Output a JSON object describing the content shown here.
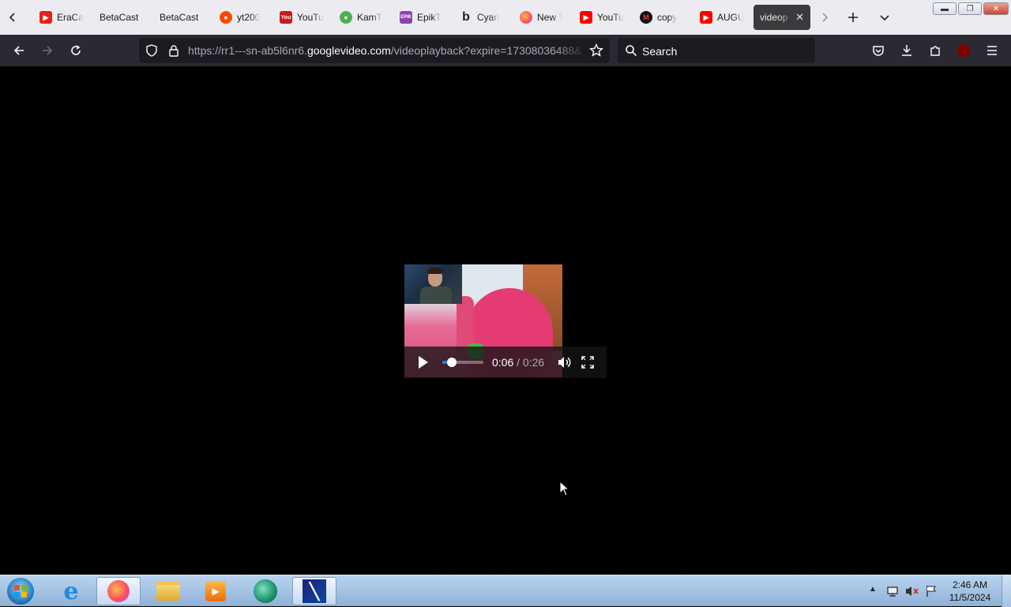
{
  "browser": {
    "tabs": [
      {
        "title": "EraCa",
        "favicon": "youtube-favicon",
        "color": "#e62117"
      },
      {
        "title": "BetaCast",
        "favicon": "none"
      },
      {
        "title": "BetaCast",
        "favicon": "none"
      },
      {
        "title": "yt200",
        "favicon": "reddit-favicon",
        "color": "#ff4500"
      },
      {
        "title": "YouTu",
        "favicon": "youtube-old-favicon",
        "color": "#cc181e"
      },
      {
        "title": "KamT",
        "favicon": "green-favicon",
        "color": "#4caf50"
      },
      {
        "title": "EpikT",
        "favicon": "epik-favicon",
        "color": "#8e44ad"
      },
      {
        "title": "Cyan",
        "favicon": "b-favicon",
        "color": "#222222"
      },
      {
        "title": "New T",
        "favicon": "firefox-favicon",
        "color": "#ff7139"
      },
      {
        "title": "YouTu",
        "favicon": "youtube-favicon",
        "color": "#ff0000"
      },
      {
        "title": "copy",
        "favicon": "m-favicon",
        "color": "#c2185b"
      },
      {
        "title": "AUGU",
        "favicon": "youtube-favicon",
        "color": "#ff0000"
      },
      {
        "title": "videop",
        "favicon": "none",
        "active": true
      }
    ],
    "url_prefix": "https://rr1---sn-ab5l6nr6.",
    "url_host": "googlevideo.com",
    "url_suffix": "/videoplayback?expire=17308036488&",
    "search_placeholder": "Search"
  },
  "player": {
    "current_time": "0:06",
    "separator": "/",
    "duration": "0:26",
    "progress": 0.23
  },
  "taskbar": {
    "clock_time": "2:46 AM",
    "clock_date": "11/5/2024"
  },
  "colors": {
    "tabbar_bg": "#ececf0",
    "navbar_bg": "#2b2a33",
    "urlbar_bg": "#1c1b22",
    "ublock_red": "#800000",
    "progress_accent": "#0b84ff"
  }
}
